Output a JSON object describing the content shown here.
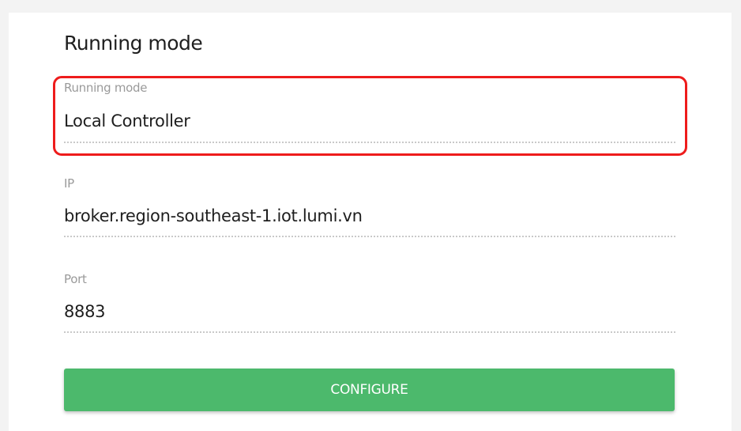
{
  "section": {
    "title": "Running mode"
  },
  "fields": {
    "running_mode": {
      "label": "Running mode",
      "value": "Local Controller"
    },
    "ip": {
      "label": "IP",
      "value": "broker.region-southeast-1.iot.lumi.vn"
    },
    "port": {
      "label": "Port",
      "value": "8883"
    }
  },
  "actions": {
    "configure_label": "CONFIGURE"
  },
  "colors": {
    "highlight_border": "#ee1c1c",
    "button_background": "#4cb96c",
    "button_text": "#ffffff",
    "label_text": "#9a9a9a",
    "value_text": "#1e1e1e"
  }
}
